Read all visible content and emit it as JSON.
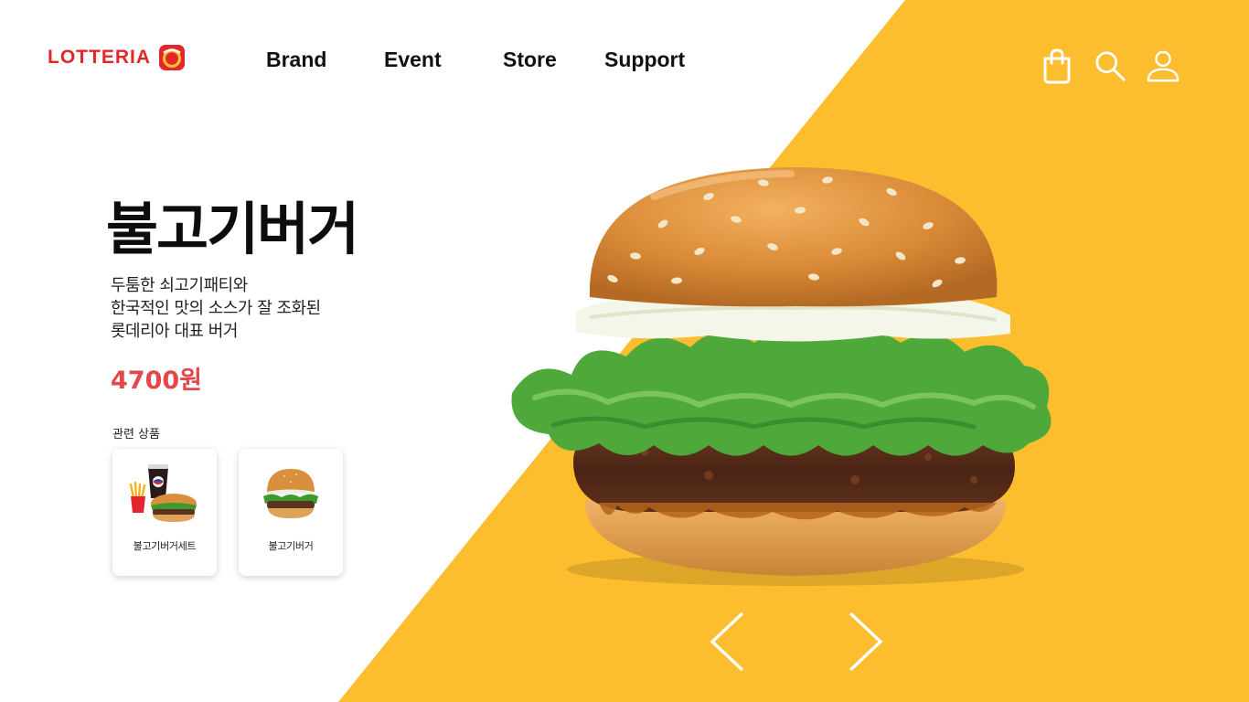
{
  "brand": {
    "logo_text": "LOTTERIA",
    "accent_color": "#e3262b",
    "background_yellow": "#fcbd2f"
  },
  "nav": {
    "items": [
      {
        "label": "Brand"
      },
      {
        "label": "Event"
      },
      {
        "label": "Store"
      },
      {
        "label": "Support"
      }
    ]
  },
  "header_icons": [
    "shopping-bag-icon",
    "search-icon",
    "user-icon"
  ],
  "product": {
    "title": "불고기버거",
    "description": [
      "두툼한 쇠고기패티와",
      "한국적인 맛의 소스가 잘 조화된",
      "롯데리아 대표 버거"
    ],
    "price": "4700원",
    "price_color": "#e3474a"
  },
  "related": {
    "label": "관련 상품",
    "items": [
      {
        "name": "불고기버거세트"
      },
      {
        "name": "불고기버거"
      }
    ]
  },
  "carousel": {
    "prev_icon": "chevron-left-icon",
    "next_icon": "chevron-right-icon"
  }
}
